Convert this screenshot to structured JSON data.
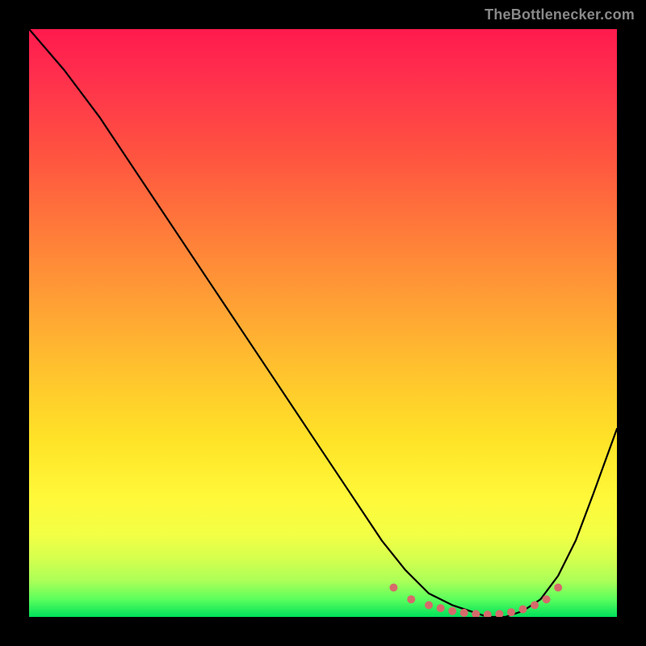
{
  "watermark": "TheBottlenecker.com",
  "chart_data": {
    "type": "line",
    "title": "",
    "xlabel": "",
    "ylabel": "",
    "xlim": [
      0,
      100
    ],
    "ylim": [
      0,
      100
    ],
    "grid": false,
    "legend": false,
    "series": [
      {
        "name": "curve",
        "x": [
          0,
          6,
          12,
          18,
          24,
          30,
          36,
          42,
          48,
          54,
          60,
          64,
          68,
          72,
          75,
          78,
          81,
          84,
          87,
          90,
          93,
          96,
          100
        ],
        "y": [
          100,
          93,
          85,
          76,
          67,
          58,
          49,
          40,
          31,
          22,
          13,
          8,
          4,
          2,
          1,
          0,
          0,
          1,
          3,
          7,
          13,
          21,
          32
        ]
      },
      {
        "name": "marker-cluster",
        "x": [
          62,
          65,
          68,
          70,
          72,
          74,
          76,
          78,
          80,
          82,
          84,
          86,
          88,
          90
        ],
        "y": [
          5,
          3,
          2,
          1.5,
          1,
          0.7,
          0.5,
          0.4,
          0.5,
          0.8,
          1.3,
          2,
          3,
          5
        ]
      }
    ],
    "colors": {
      "curve": "#000000",
      "markers": "#d66a6a",
      "gradient_top": "#ff1a4d",
      "gradient_bottom": "#00e05a"
    }
  }
}
